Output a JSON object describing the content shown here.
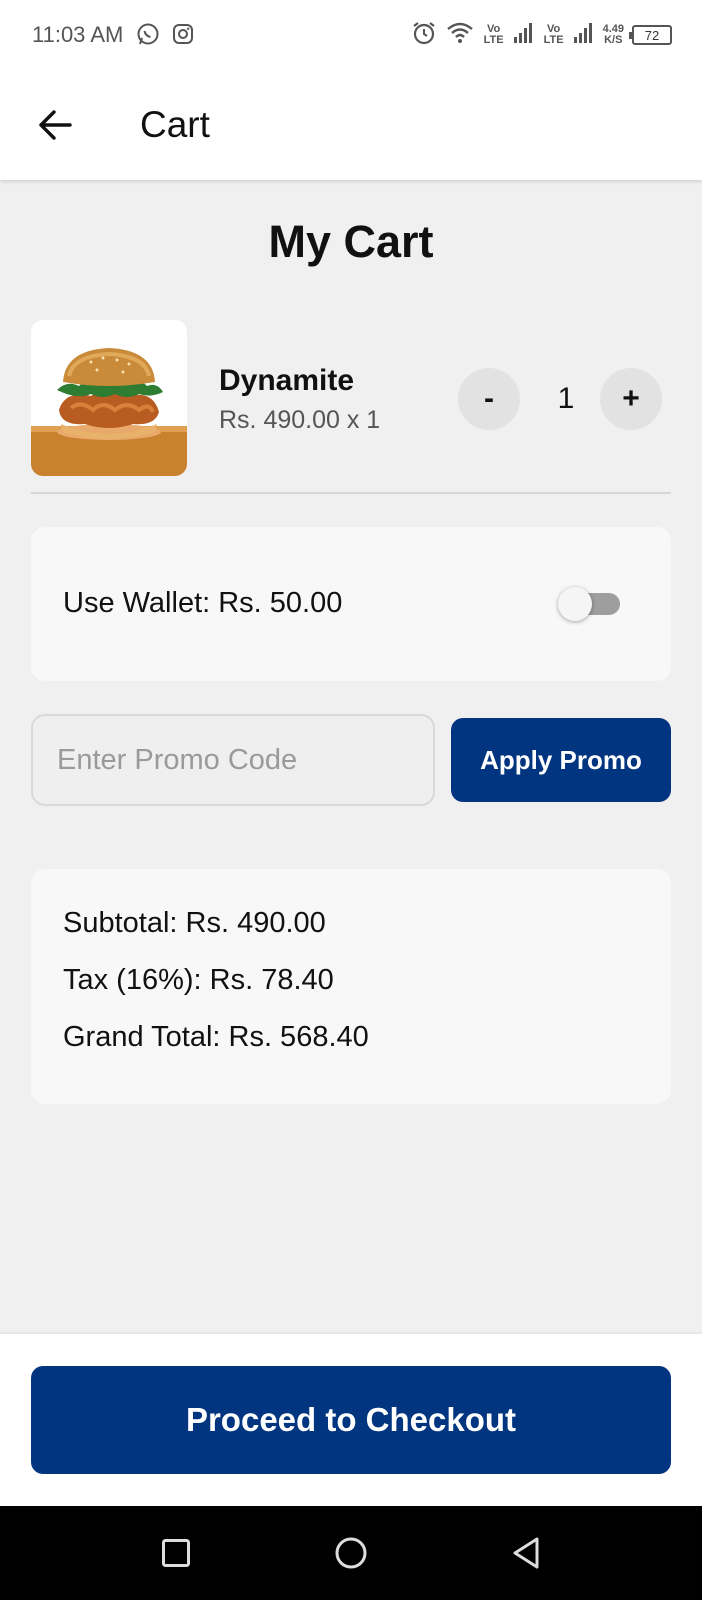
{
  "status_bar": {
    "time": "11:03 AM",
    "app_icons": [
      "whatsapp-icon",
      "instagram-icon"
    ],
    "network_1": "Vo LTE",
    "network_2": "Vo LTE",
    "speed_value": "4.49",
    "speed_unit": "K/S",
    "battery": "72"
  },
  "app_bar": {
    "title": "Cart",
    "back_icon": "arrow-left-icon"
  },
  "main": {
    "page_title": "My Cart",
    "cart_items": [
      {
        "name": "Dynamite",
        "price_line": "Rs. 490.00 x 1",
        "quantity": "1",
        "minus_label": "-",
        "plus_label": "+",
        "image_icon": "burger-image"
      }
    ],
    "wallet": {
      "label": "Use Wallet: Rs. 50.00",
      "toggle_on": false
    },
    "promo": {
      "value": "",
      "placeholder": "Enter Promo Code",
      "apply_label": "Apply Promo"
    },
    "totals": {
      "subtotal": "Subtotal: Rs. 490.00",
      "tax": "Tax (16%): Rs. 78.40",
      "grand_total": "Grand Total: Rs. 568.40"
    }
  },
  "checkout": {
    "label": "Proceed to Checkout"
  },
  "nav_bar": {
    "items": [
      "recent-apps-icon",
      "home-icon",
      "back-icon"
    ]
  },
  "colors": {
    "primary": "#02357f",
    "background": "#f0f0f0",
    "card": "#f8f8f8"
  }
}
